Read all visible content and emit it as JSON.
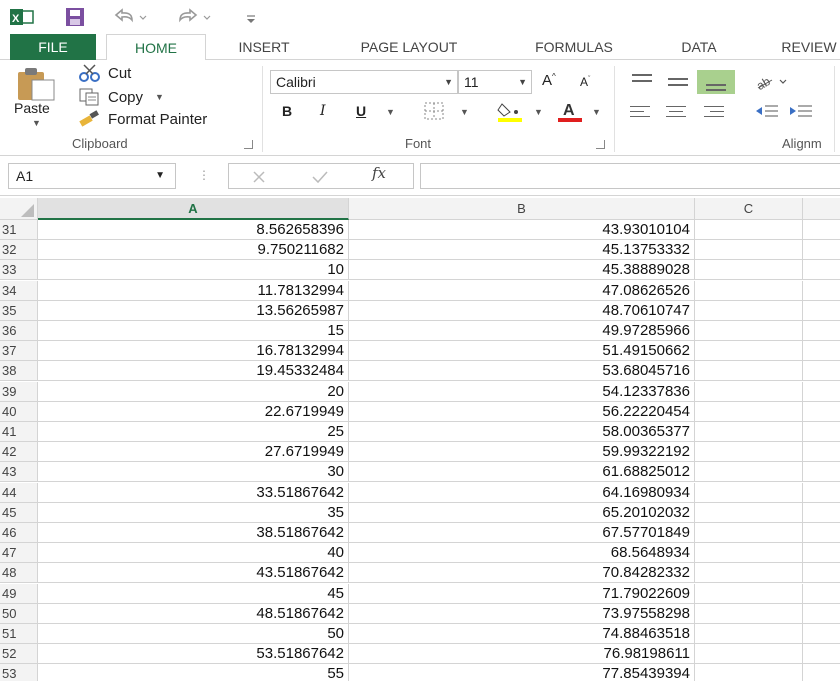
{
  "app": {
    "tabs": [
      "FILE",
      "HOME",
      "INSERT",
      "PAGE LAYOUT",
      "FORMULAS",
      "DATA",
      "REVIEW"
    ],
    "active_tab": "HOME",
    "accent_color": "#217346"
  },
  "clipboard": {
    "paste_label": "Paste",
    "cut_label": "Cut",
    "copy_label": "Copy",
    "format_painter_label": "Format Painter",
    "group_label": "Clipboard"
  },
  "font": {
    "name": "Calibri",
    "size": "11",
    "bold": "B",
    "italic": "I",
    "underline": "U",
    "group_label": "Font"
  },
  "alignment": {
    "group_label": "Alignm"
  },
  "formula_bar": {
    "name_box": "A1",
    "fx": "fx",
    "value": ""
  },
  "sheet": {
    "columns": [
      "A",
      "B",
      "C"
    ],
    "selected_column": "A",
    "rows": [
      {
        "label": "31",
        "a": "8.562658396",
        "b": "43.93010104"
      },
      {
        "label": "32",
        "a": "9.750211682",
        "b": "45.13753332"
      },
      {
        "label": "33",
        "a": "10",
        "b": "45.38889028"
      },
      {
        "label": "34",
        "a": "11.78132994",
        "b": "47.08626526"
      },
      {
        "label": "35",
        "a": "13.56265987",
        "b": "48.70610747"
      },
      {
        "label": "36",
        "a": "15",
        "b": "49.97285966"
      },
      {
        "label": "37",
        "a": "16.78132994",
        "b": "51.49150662"
      },
      {
        "label": "38",
        "a": "19.45332484",
        "b": "53.68045716"
      },
      {
        "label": "39",
        "a": "20",
        "b": "54.12337836"
      },
      {
        "label": "40",
        "a": "22.6719949",
        "b": "56.22220454"
      },
      {
        "label": "41",
        "a": "25",
        "b": "58.00365377"
      },
      {
        "label": "42",
        "a": "27.6719949",
        "b": "59.99322192"
      },
      {
        "label": "43",
        "a": "30",
        "b": "61.68825012"
      },
      {
        "label": "44",
        "a": "33.51867642",
        "b": "64.16980934"
      },
      {
        "label": "45",
        "a": "35",
        "b": "65.20102032"
      },
      {
        "label": "46",
        "a": "38.51867642",
        "b": "67.57701849"
      },
      {
        "label": "47",
        "a": "40",
        "b": "68.5648934"
      },
      {
        "label": "48",
        "a": "43.51867642",
        "b": "70.84282332"
      },
      {
        "label": "49",
        "a": "45",
        "b": "71.79022609"
      },
      {
        "label": "50",
        "a": "48.51867642",
        "b": "73.97558298"
      },
      {
        "label": "51",
        "a": "50",
        "b": "74.88463518"
      },
      {
        "label": "52",
        "a": "53.51867642",
        "b": "76.98198611"
      },
      {
        "label": "53",
        "a": "55",
        "b": "77.85439394"
      }
    ]
  }
}
